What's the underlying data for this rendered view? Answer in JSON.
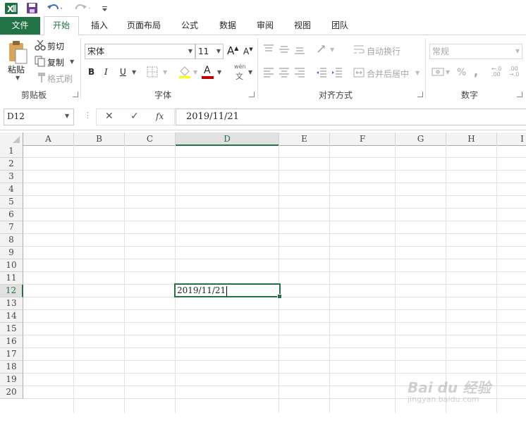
{
  "qat": {
    "excel_icon": "excel-logo-icon",
    "save_icon": "save-icon",
    "undo_icon": "undo-icon",
    "redo_icon": "redo-icon",
    "customize_icon": "customize-qat-icon"
  },
  "tabs": [
    "文件",
    "开始",
    "插入",
    "页面布局",
    "公式",
    "数据",
    "审阅",
    "视图",
    "团队"
  ],
  "ribbon": {
    "clipboard": {
      "paste": "粘贴",
      "cut": "剪切",
      "copy": "复制",
      "format_painter": "格式刷",
      "label": "剪贴板"
    },
    "font": {
      "font_name": "宋体",
      "font_size": "11",
      "bold": "B",
      "italic": "I",
      "underline": "U",
      "grow": "A",
      "shrink": "A",
      "font_color_letter": "A",
      "phonetic_top": "wén",
      "phonetic_bottom": "文",
      "label": "字体"
    },
    "alignment": {
      "wrap_text": "自动换行",
      "merge_center": "合并后居中",
      "label": "对齐方式"
    },
    "number": {
      "format": "常规",
      "percent": "%",
      "comma": ",",
      "inc_decimal": "←.0 .00",
      "dec_decimal": ".00 →.0",
      "label": "数字"
    },
    "colors": {
      "accent": "#217346",
      "font_color_bar": "#c00000"
    }
  },
  "formula_bar": {
    "name_box": "D12",
    "cancel": "✕",
    "enter": "✓",
    "fx": "fx",
    "value": "2019/11/21"
  },
  "grid": {
    "columns": [
      "A",
      "B",
      "C",
      "D",
      "E",
      "F",
      "G",
      "H",
      "I"
    ],
    "rows": [
      "1",
      "2",
      "3",
      "4",
      "5",
      "6",
      "7",
      "8",
      "9",
      "10",
      "11",
      "12",
      "13",
      "14",
      "15",
      "16",
      "17",
      "18",
      "19",
      "20"
    ],
    "selected_column": "D",
    "selected_row": "12",
    "active_cell_value": "2019/11/21"
  },
  "watermark": {
    "brand": "Bai du 经验",
    "url": "jingyan.baidu.com"
  }
}
